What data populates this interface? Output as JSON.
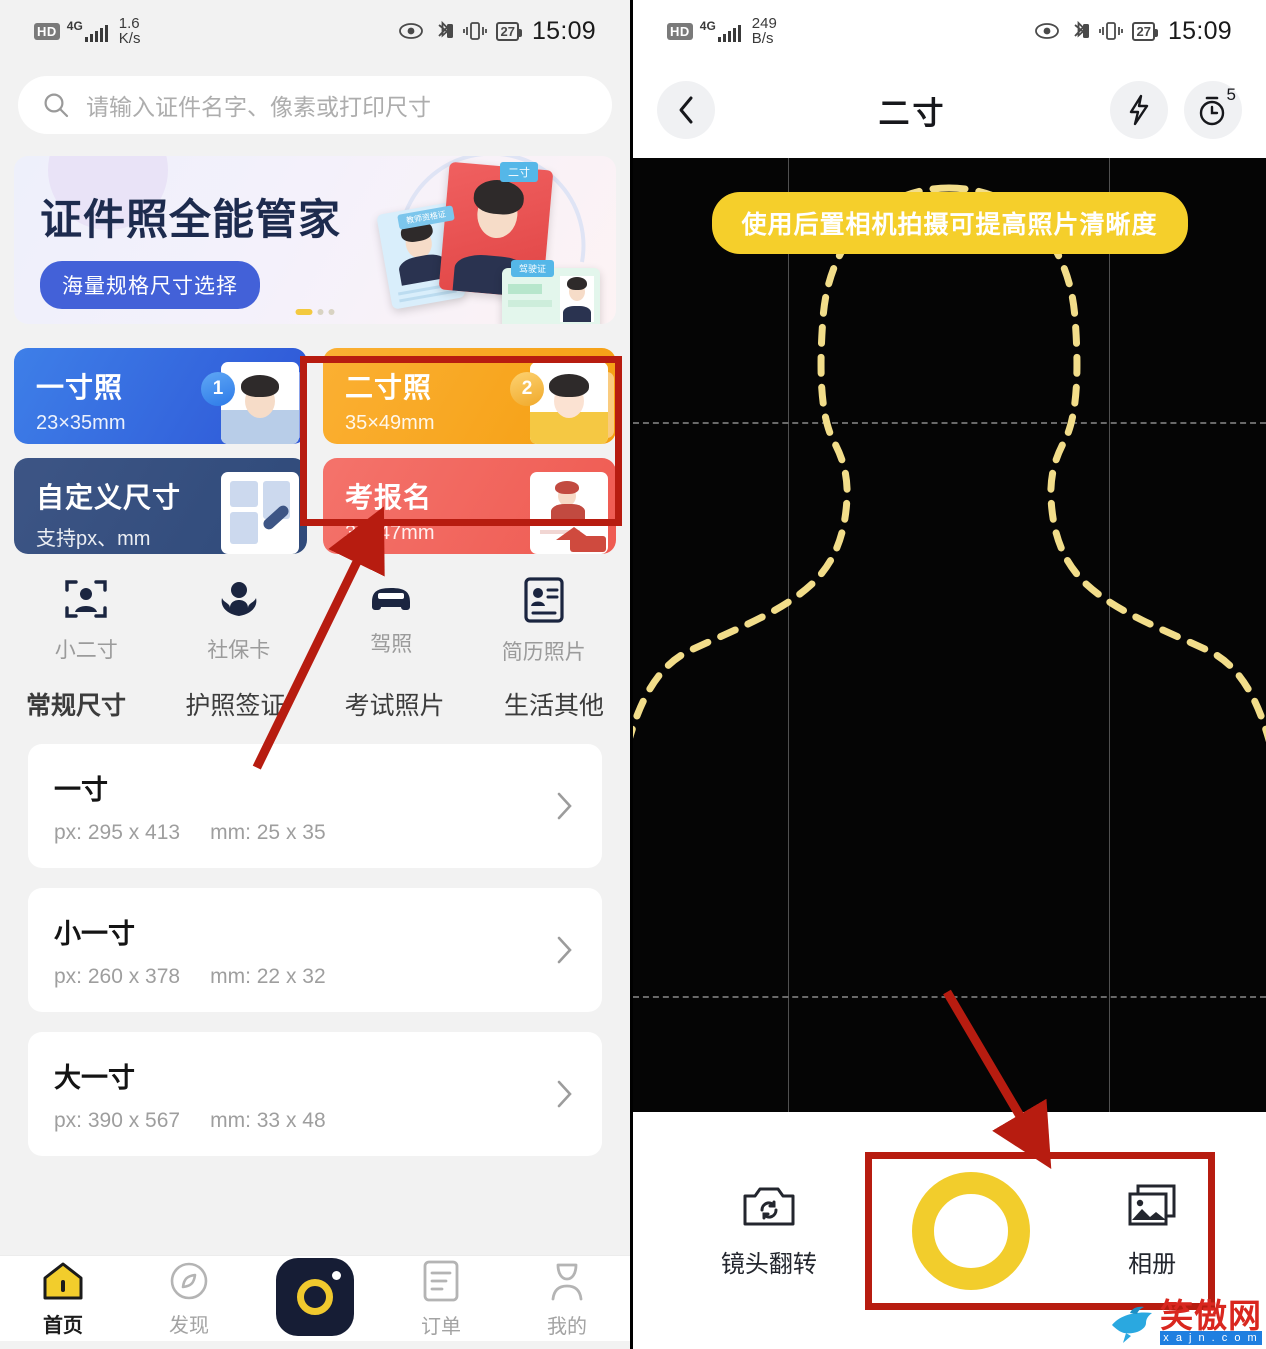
{
  "left_phone": {
    "status_bar": {
      "hd": "HD",
      "network": "4G",
      "speed_value": "1.6",
      "speed_unit": "K/s",
      "battery": "27",
      "time": "15:09"
    },
    "search": {
      "placeholder": "请输入证件名字、像素或打印尺寸",
      "icon": "search-icon"
    },
    "banner": {
      "title": "证件照全能管家",
      "pill": "海量规格尺寸选择",
      "tag_main": "二寸",
      "tag_left": "教师资格证",
      "tag_dl": "驾驶证"
    },
    "quick_cards": [
      {
        "title": "一寸照",
        "size": "23×35mm",
        "badge": "1",
        "theme": "blue"
      },
      {
        "title": "二寸照",
        "size": "35×49mm",
        "badge": "2",
        "theme": "orange"
      },
      {
        "title": "自定义尺寸",
        "size": "支持px、mm",
        "badge": "",
        "theme": "navy"
      },
      {
        "title": "考报名",
        "size": "36×47mm",
        "badge": "",
        "theme": "red"
      }
    ],
    "icon_row": [
      {
        "label": "小二寸",
        "icon": "portrait-frame-icon"
      },
      {
        "label": "社保卡",
        "icon": "hands-care-icon"
      },
      {
        "label": "驾照",
        "icon": "car-icon"
      },
      {
        "label": "简历照片",
        "icon": "id-card-icon"
      }
    ],
    "tabs": [
      {
        "label": "常规尺寸",
        "active": true
      },
      {
        "label": "护照签证",
        "active": false
      },
      {
        "label": "考试照片",
        "active": false
      },
      {
        "label": "生活其他",
        "active": false
      }
    ],
    "size_list": [
      {
        "name": "一寸",
        "px": "px: 295 x 413",
        "mm": "mm: 25 x 35"
      },
      {
        "name": "小一寸",
        "px": "px: 260 x 378",
        "mm": "mm: 22 x 32"
      },
      {
        "name": "大一寸",
        "px": "px: 390 x 567",
        "mm": "mm: 33 x 48"
      }
    ],
    "bottom_nav": [
      {
        "label": "首页",
        "icon": "home-icon",
        "active": true
      },
      {
        "label": "发现",
        "icon": "compass-icon",
        "active": false
      },
      {
        "label": "",
        "icon": "camera-fab-icon",
        "active": false
      },
      {
        "label": "订单",
        "icon": "order-list-icon",
        "active": false
      },
      {
        "label": "我的",
        "icon": "user-icon",
        "active": false
      }
    ]
  },
  "right_phone": {
    "status_bar": {
      "hd": "HD",
      "network": "4G",
      "speed_value": "249",
      "speed_unit": "B/s",
      "battery": "27",
      "time": "15:09"
    },
    "header": {
      "back_icon": "chevron-left-icon",
      "title": "二寸",
      "flash_icon": "flash-icon",
      "timer_icon": "timer-icon",
      "timer_value": "5"
    },
    "tip": "使用后置相机拍摄可提高照片清晰度",
    "controls": [
      {
        "label": "镜头翻转",
        "icon": "camera-flip-icon"
      },
      {
        "label": "",
        "icon": "shutter-icon"
      },
      {
        "label": "相册",
        "icon": "album-icon"
      }
    ]
  },
  "watermark": {
    "name": "笑傲网",
    "url": "x a j n . c o m"
  },
  "colors": {
    "accent_yellow": "#f2cd2c",
    "annotation_red": "#b71c10",
    "card_blue": "#2e56d6",
    "card_orange": "#f59f12",
    "card_navy": "#2f4a7a",
    "card_red": "#ef5b52"
  }
}
